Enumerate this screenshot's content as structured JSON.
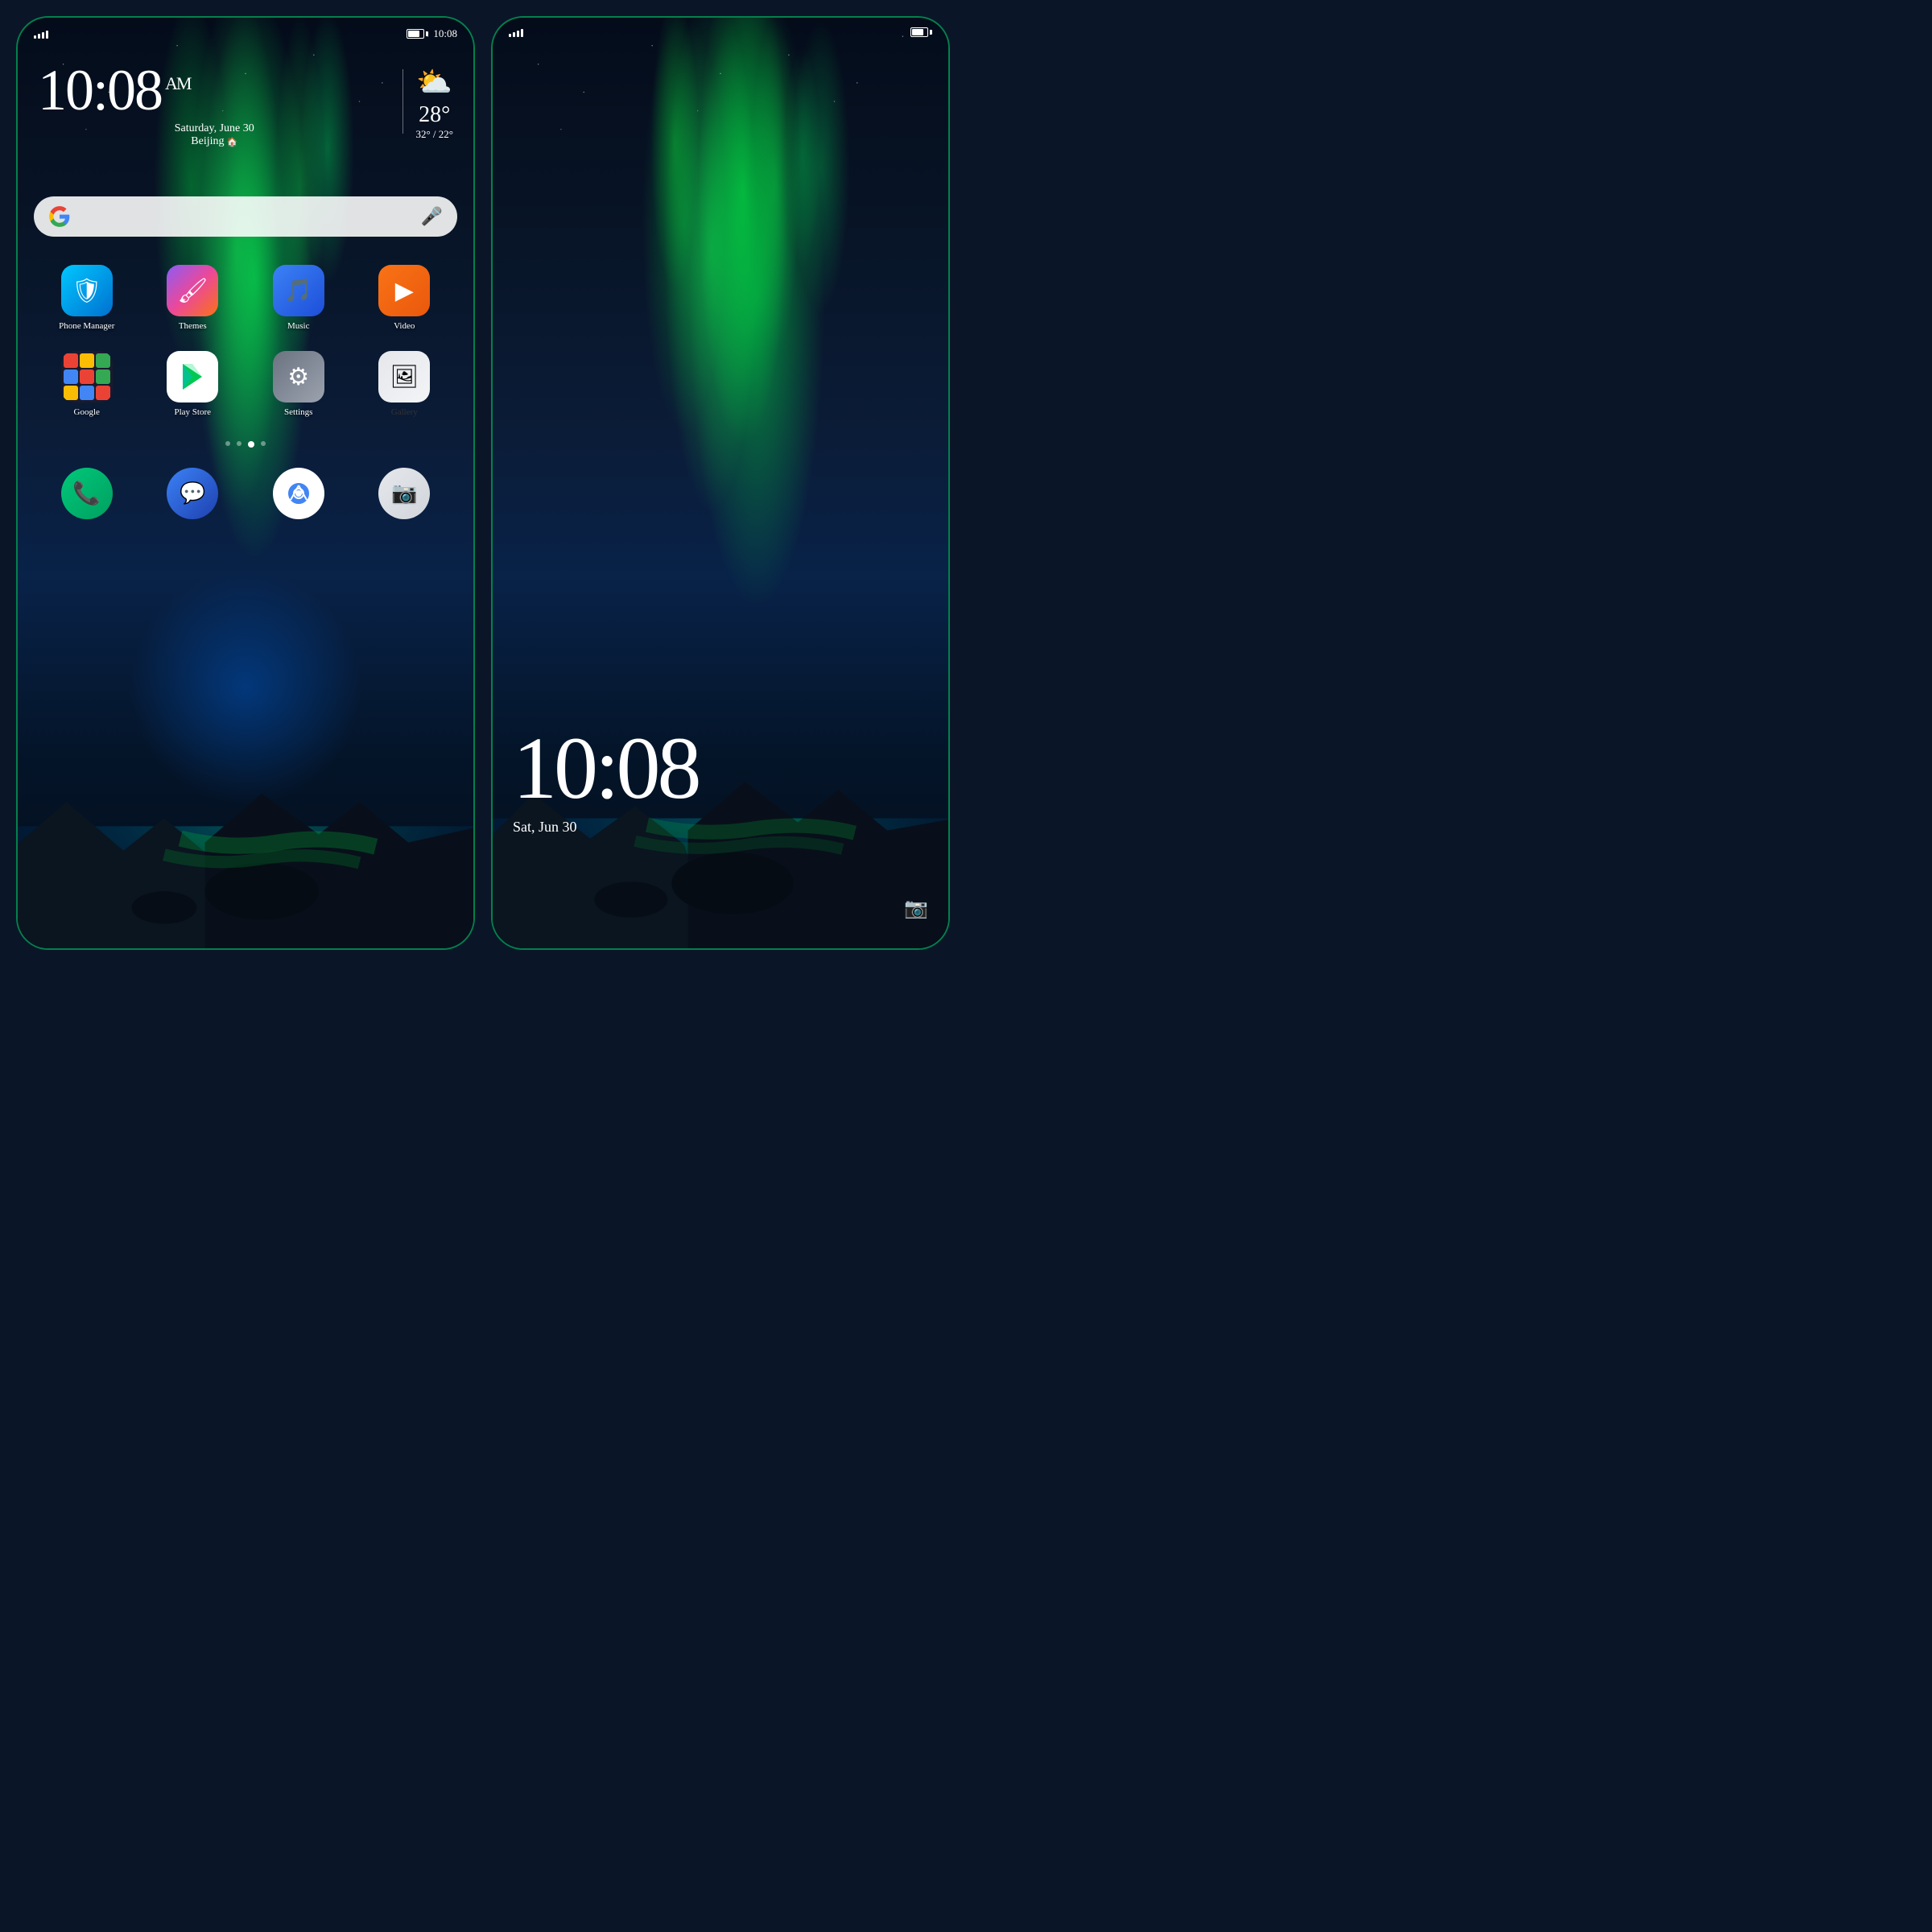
{
  "left_phone": {
    "status_bar": {
      "time": "10:08",
      "battery_label": "battery"
    },
    "clock": {
      "time": "10:08",
      "am_pm": "AM",
      "date": "Saturday, June 30",
      "location": "Beijing"
    },
    "weather": {
      "temp": "28°",
      "range": "32° / 22°"
    },
    "search": {
      "placeholder": ""
    },
    "apps_row1": [
      {
        "name": "Phone Manager",
        "icon_type": "phone-manager"
      },
      {
        "name": "Themes",
        "icon_type": "themes"
      },
      {
        "name": "Music",
        "icon_type": "music"
      },
      {
        "name": "Video",
        "icon_type": "video"
      }
    ],
    "apps_row2": [
      {
        "name": "Google",
        "icon_type": "google"
      },
      {
        "name": "Play Store",
        "icon_type": "play-store"
      },
      {
        "name": "Settings",
        "icon_type": "settings"
      },
      {
        "name": "Gallery",
        "icon_type": "gallery"
      }
    ],
    "dock": [
      {
        "name": "Phone",
        "icon_type": "phone"
      },
      {
        "name": "Messages",
        "icon_type": "messages"
      },
      {
        "name": "Chrome",
        "icon_type": "chrome"
      },
      {
        "name": "Camera",
        "icon_type": "camera"
      }
    ]
  },
  "right_phone": {
    "status_bar": {
      "time": ""
    },
    "clock": {
      "time": "10:08",
      "date": "Sat, Jun 30"
    },
    "camera_btn": "📷"
  },
  "icons": {
    "signal": "signal-icon",
    "battery": "battery-icon",
    "mic": "🎤",
    "location_pin": "🏠",
    "sun_cloud": "⛅",
    "shield": "🛡",
    "brush": "🖌",
    "music_note": "🎵",
    "play_btn": "▶",
    "gear": "⚙",
    "camera": "📷"
  }
}
